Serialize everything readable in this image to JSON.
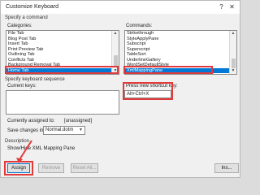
{
  "window": {
    "title": "Customize Keyboard",
    "help_glyph": "?",
    "close_glyph": "✕"
  },
  "specify_command": {
    "heading": "Specify a command",
    "categories_label": "Categories:",
    "categories": [
      {
        "label": "File Tab",
        "selected": false
      },
      {
        "label": "Blog Post Tab",
        "selected": false
      },
      {
        "label": "Insert Tab",
        "selected": false
      },
      {
        "label": "Print Preview Tab",
        "selected": false
      },
      {
        "label": "Outlining Tab",
        "selected": false
      },
      {
        "label": "Conflicts Tab",
        "selected": false
      },
      {
        "label": "Background Removal Tab",
        "selected": false
      },
      {
        "label": "Home Tab",
        "selected": true
      }
    ],
    "commands_label": "Commands:",
    "commands": [
      {
        "label": "Strikethrough",
        "selected": false
      },
      {
        "label": "StyleApplyPane",
        "selected": false
      },
      {
        "label": "Subscript",
        "selected": false
      },
      {
        "label": "Superscript",
        "selected": false
      },
      {
        "label": "TableSort",
        "selected": false
      },
      {
        "label": "UnderlineGallery",
        "selected": false
      },
      {
        "label": "WordSetDefaultStyle",
        "selected": false
      },
      {
        "label": "XmlMappingPane",
        "selected": true
      }
    ]
  },
  "keyboard_sequence": {
    "heading": "Specify keyboard sequence",
    "current_keys_label": "Current keys:",
    "current_keys_value": "",
    "new_shortcut_label": "Press new shortcut key:",
    "new_shortcut_value": "Alt+Ctrl+X",
    "assigned_label": "Currently assigned to:",
    "assigned_value": "[unassigned]",
    "save_changes_label": "Save changes in:",
    "save_changes_value": "Normal.dotm"
  },
  "description": {
    "heading": "Description",
    "text": "Show/Hide XML Mapping Pane"
  },
  "buttons": {
    "assign": "Assign",
    "remove": "Remove",
    "reset_all": "Reset All...",
    "close_partial": "Ins..."
  },
  "colors": {
    "selection": "#0078d7",
    "annotation": "#e23a3a"
  },
  "icons": {
    "help": "help-icon",
    "close": "close-icon",
    "dropdown": "chevron-down-icon",
    "scroll_up": "scroll-up-arrow-icon",
    "scroll_down": "scroll-down-arrow-icon"
  }
}
